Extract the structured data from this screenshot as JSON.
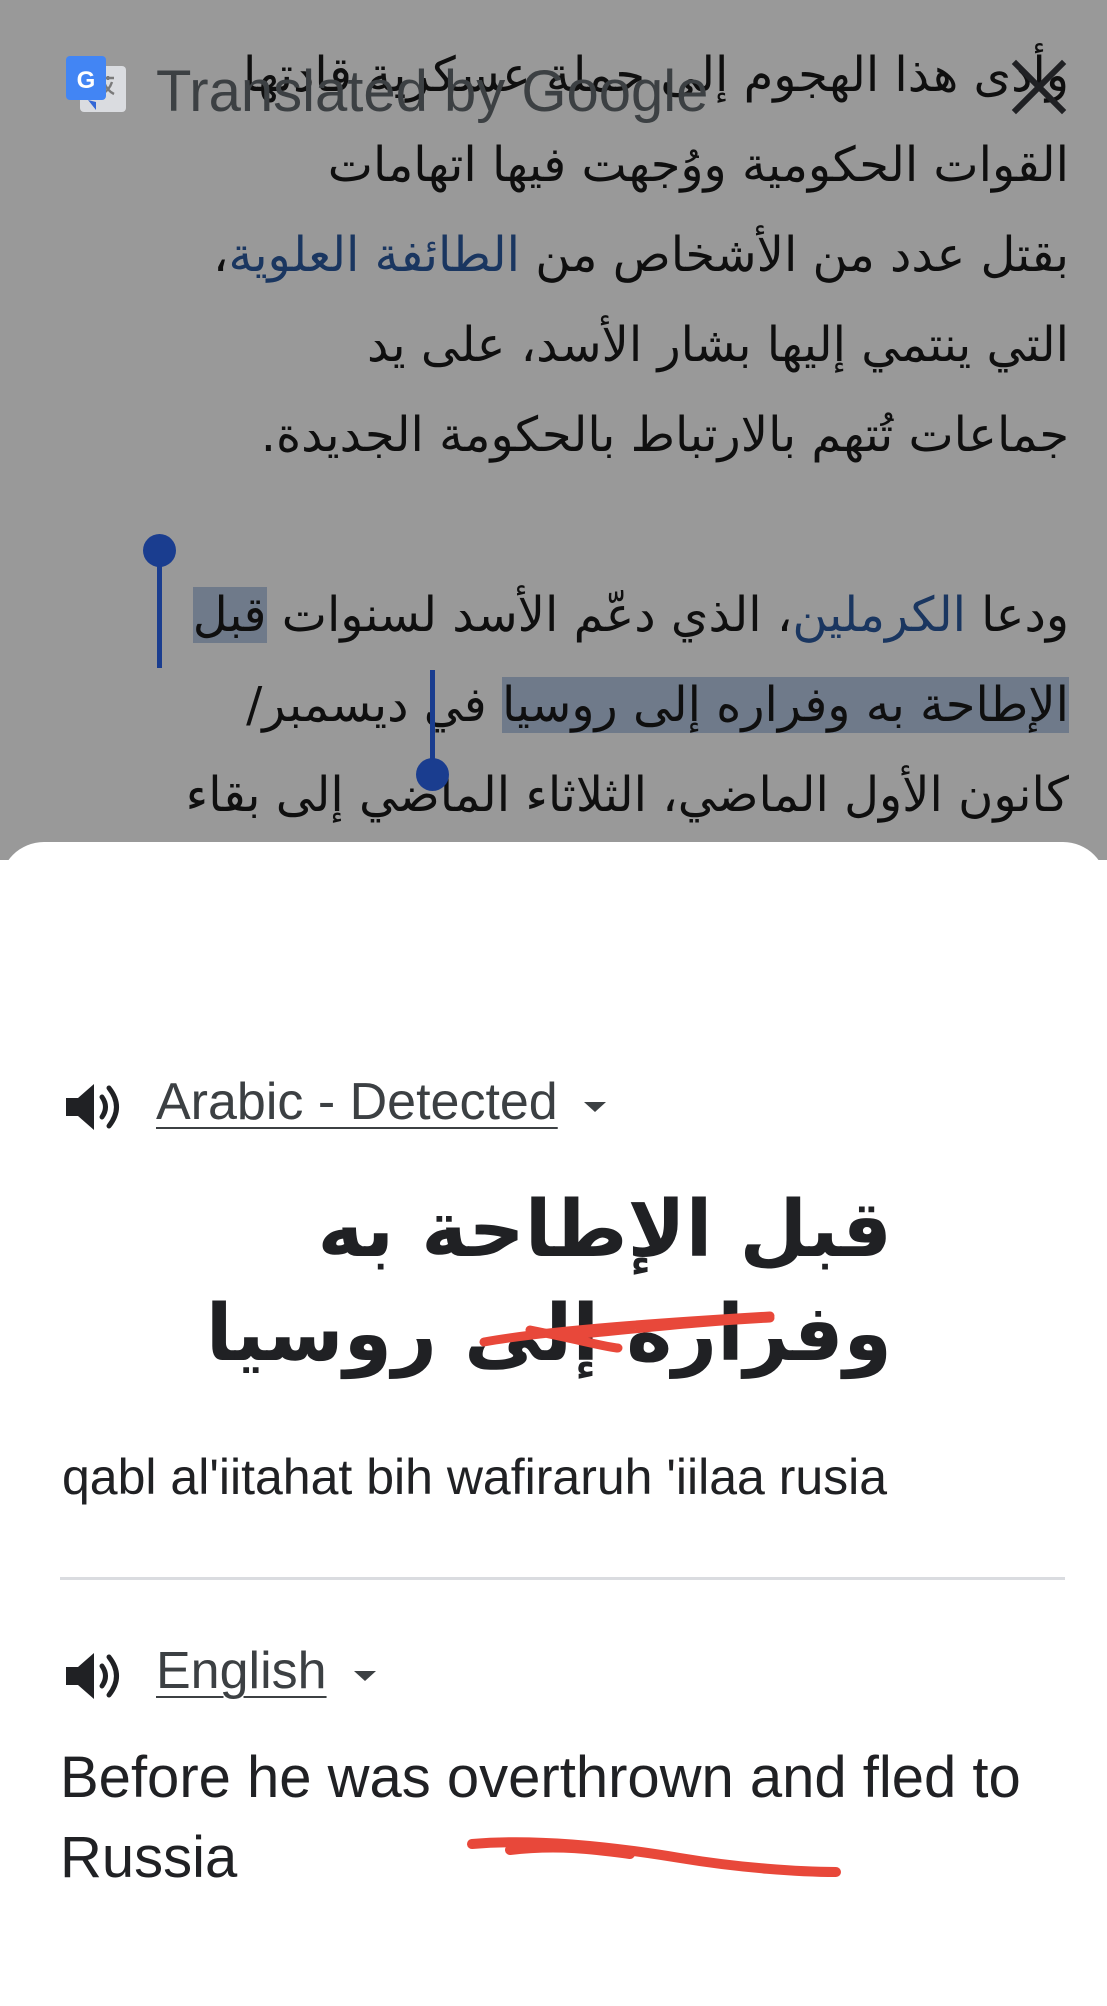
{
  "article": {
    "paragraph1": {
      "line1": "وأدى هذا الهجوم إلى حملة عسكرية قادتها",
      "line2": "القوات الحكومية ووُجهت فيها اتهامات",
      "line3_text": "بقتل عدد من الأشخاص من ",
      "line3_link": "الطائفة العلوية",
      "line3_end": "،",
      "line4": "التي ينتمي إليها بشار الأسد، على يد",
      "line5": "جماعات تُتهم بالارتباط بالحكومة الجديدة."
    },
    "paragraph2": {
      "line1_start": "ودعا ",
      "line1_link": "الكرملين",
      "line1_mid": "، الذي دعّم الأسد لسنوات ",
      "line1_selected": "قبل",
      "line2_selected": "الإطاحة به وفراره إلى روسيا",
      "line2_rest": " في ديسمبر/",
      "line3": "كانون الأول الماضي، الثلاثاء الماضي إلى بقاء"
    }
  },
  "translate_sheet": {
    "title": "Translated by Google",
    "close_icon": "close-icon",
    "source": {
      "language_label": "Arabic - Detected",
      "text": "قبل الإطاحة به وفراره إلى روسيا",
      "transliteration": "qabl al'iitahat bih wafiraruh 'iilaa rusia"
    },
    "target": {
      "language_label": "English",
      "text": "Before he was overthrown and fled to Russia"
    }
  },
  "colors": {
    "selection": "#b9cbe6",
    "handle": "#1a3d8f",
    "link": "#2c5aa0",
    "annotation_red": "#e8483a",
    "google_blue": "#4285f4"
  }
}
